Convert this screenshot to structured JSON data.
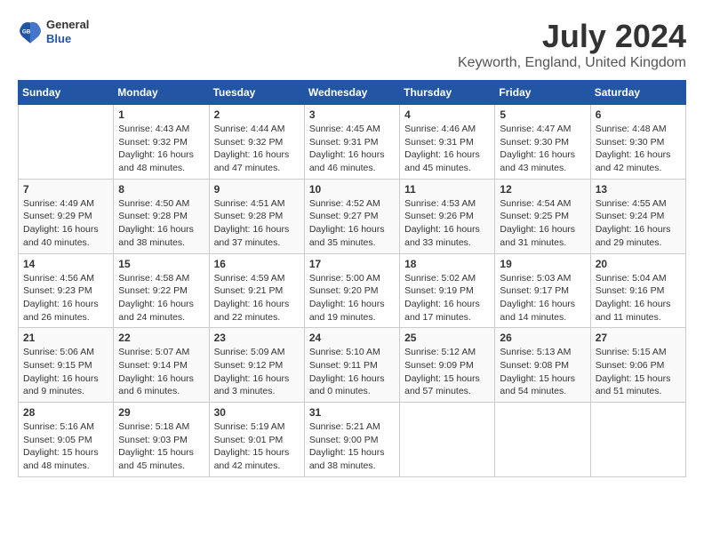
{
  "title": "July 2024",
  "subtitle": "Keyworth, England, United Kingdom",
  "logo": {
    "line1": "General",
    "line2": "Blue"
  },
  "days_of_week": [
    "Sunday",
    "Monday",
    "Tuesday",
    "Wednesday",
    "Thursday",
    "Friday",
    "Saturday"
  ],
  "weeks": [
    [
      {
        "day": "",
        "sunrise": "",
        "sunset": "",
        "daylight": ""
      },
      {
        "day": "1",
        "sunrise": "Sunrise: 4:43 AM",
        "sunset": "Sunset: 9:32 PM",
        "daylight": "Daylight: 16 hours and 48 minutes."
      },
      {
        "day": "2",
        "sunrise": "Sunrise: 4:44 AM",
        "sunset": "Sunset: 9:32 PM",
        "daylight": "Daylight: 16 hours and 47 minutes."
      },
      {
        "day": "3",
        "sunrise": "Sunrise: 4:45 AM",
        "sunset": "Sunset: 9:31 PM",
        "daylight": "Daylight: 16 hours and 46 minutes."
      },
      {
        "day": "4",
        "sunrise": "Sunrise: 4:46 AM",
        "sunset": "Sunset: 9:31 PM",
        "daylight": "Daylight: 16 hours and 45 minutes."
      },
      {
        "day": "5",
        "sunrise": "Sunrise: 4:47 AM",
        "sunset": "Sunset: 9:30 PM",
        "daylight": "Daylight: 16 hours and 43 minutes."
      },
      {
        "day": "6",
        "sunrise": "Sunrise: 4:48 AM",
        "sunset": "Sunset: 9:30 PM",
        "daylight": "Daylight: 16 hours and 42 minutes."
      }
    ],
    [
      {
        "day": "7",
        "sunrise": "Sunrise: 4:49 AM",
        "sunset": "Sunset: 9:29 PM",
        "daylight": "Daylight: 16 hours and 40 minutes."
      },
      {
        "day": "8",
        "sunrise": "Sunrise: 4:50 AM",
        "sunset": "Sunset: 9:28 PM",
        "daylight": "Daylight: 16 hours and 38 minutes."
      },
      {
        "day": "9",
        "sunrise": "Sunrise: 4:51 AM",
        "sunset": "Sunset: 9:28 PM",
        "daylight": "Daylight: 16 hours and 37 minutes."
      },
      {
        "day": "10",
        "sunrise": "Sunrise: 4:52 AM",
        "sunset": "Sunset: 9:27 PM",
        "daylight": "Daylight: 16 hours and 35 minutes."
      },
      {
        "day": "11",
        "sunrise": "Sunrise: 4:53 AM",
        "sunset": "Sunset: 9:26 PM",
        "daylight": "Daylight: 16 hours and 33 minutes."
      },
      {
        "day": "12",
        "sunrise": "Sunrise: 4:54 AM",
        "sunset": "Sunset: 9:25 PM",
        "daylight": "Daylight: 16 hours and 31 minutes."
      },
      {
        "day": "13",
        "sunrise": "Sunrise: 4:55 AM",
        "sunset": "Sunset: 9:24 PM",
        "daylight": "Daylight: 16 hours and 29 minutes."
      }
    ],
    [
      {
        "day": "14",
        "sunrise": "Sunrise: 4:56 AM",
        "sunset": "Sunset: 9:23 PM",
        "daylight": "Daylight: 16 hours and 26 minutes."
      },
      {
        "day": "15",
        "sunrise": "Sunrise: 4:58 AM",
        "sunset": "Sunset: 9:22 PM",
        "daylight": "Daylight: 16 hours and 24 minutes."
      },
      {
        "day": "16",
        "sunrise": "Sunrise: 4:59 AM",
        "sunset": "Sunset: 9:21 PM",
        "daylight": "Daylight: 16 hours and 22 minutes."
      },
      {
        "day": "17",
        "sunrise": "Sunrise: 5:00 AM",
        "sunset": "Sunset: 9:20 PM",
        "daylight": "Daylight: 16 hours and 19 minutes."
      },
      {
        "day": "18",
        "sunrise": "Sunrise: 5:02 AM",
        "sunset": "Sunset: 9:19 PM",
        "daylight": "Daylight: 16 hours and 17 minutes."
      },
      {
        "day": "19",
        "sunrise": "Sunrise: 5:03 AM",
        "sunset": "Sunset: 9:17 PM",
        "daylight": "Daylight: 16 hours and 14 minutes."
      },
      {
        "day": "20",
        "sunrise": "Sunrise: 5:04 AM",
        "sunset": "Sunset: 9:16 PM",
        "daylight": "Daylight: 16 hours and 11 minutes."
      }
    ],
    [
      {
        "day": "21",
        "sunrise": "Sunrise: 5:06 AM",
        "sunset": "Sunset: 9:15 PM",
        "daylight": "Daylight: 16 hours and 9 minutes."
      },
      {
        "day": "22",
        "sunrise": "Sunrise: 5:07 AM",
        "sunset": "Sunset: 9:14 PM",
        "daylight": "Daylight: 16 hours and 6 minutes."
      },
      {
        "day": "23",
        "sunrise": "Sunrise: 5:09 AM",
        "sunset": "Sunset: 9:12 PM",
        "daylight": "Daylight: 16 hours and 3 minutes."
      },
      {
        "day": "24",
        "sunrise": "Sunrise: 5:10 AM",
        "sunset": "Sunset: 9:11 PM",
        "daylight": "Daylight: 16 hours and 0 minutes."
      },
      {
        "day": "25",
        "sunrise": "Sunrise: 5:12 AM",
        "sunset": "Sunset: 9:09 PM",
        "daylight": "Daylight: 15 hours and 57 minutes."
      },
      {
        "day": "26",
        "sunrise": "Sunrise: 5:13 AM",
        "sunset": "Sunset: 9:08 PM",
        "daylight": "Daylight: 15 hours and 54 minutes."
      },
      {
        "day": "27",
        "sunrise": "Sunrise: 5:15 AM",
        "sunset": "Sunset: 9:06 PM",
        "daylight": "Daylight: 15 hours and 51 minutes."
      }
    ],
    [
      {
        "day": "28",
        "sunrise": "Sunrise: 5:16 AM",
        "sunset": "Sunset: 9:05 PM",
        "daylight": "Daylight: 15 hours and 48 minutes."
      },
      {
        "day": "29",
        "sunrise": "Sunrise: 5:18 AM",
        "sunset": "Sunset: 9:03 PM",
        "daylight": "Daylight: 15 hours and 45 minutes."
      },
      {
        "day": "30",
        "sunrise": "Sunrise: 5:19 AM",
        "sunset": "Sunset: 9:01 PM",
        "daylight": "Daylight: 15 hours and 42 minutes."
      },
      {
        "day": "31",
        "sunrise": "Sunrise: 5:21 AM",
        "sunset": "Sunset: 9:00 PM",
        "daylight": "Daylight: 15 hours and 38 minutes."
      },
      {
        "day": "",
        "sunrise": "",
        "sunset": "",
        "daylight": ""
      },
      {
        "day": "",
        "sunrise": "",
        "sunset": "",
        "daylight": ""
      },
      {
        "day": "",
        "sunrise": "",
        "sunset": "",
        "daylight": ""
      }
    ]
  ]
}
